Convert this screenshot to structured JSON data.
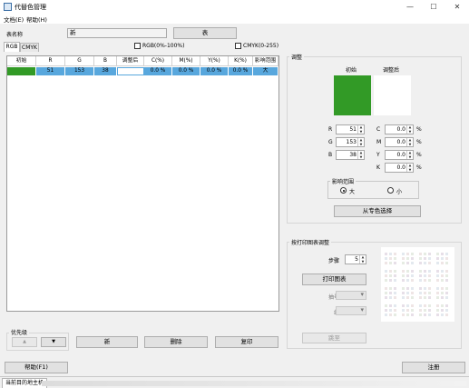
{
  "window": {
    "title": "代替色管理",
    "minimize_glyph": "—",
    "maximize_glyph": "☐",
    "close_glyph": "✕"
  },
  "menu": {
    "file": "文档(E)",
    "help": "帮助(H)"
  },
  "table_name": {
    "label": "表名称",
    "value": "新",
    "button": "表"
  },
  "tabs": {
    "rgb": "RGB",
    "cmyk": "CMYK"
  },
  "options": {
    "rgb_percent": "RGB(0%-100%)",
    "cmyk_range": "CMYK(0-255)"
  },
  "grid": {
    "headers": [
      "初始",
      "R",
      "G",
      "B",
      "调整后",
      "C(%)",
      "M(%)",
      "Y(%)",
      "K(%)",
      "影响范围"
    ],
    "rows": [
      {
        "swatch_color": "#329a26",
        "r": "51",
        "g": "153",
        "b": "38",
        "after_color": "#ffffff",
        "c": "0.0 %",
        "m": "0.0 %",
        "y": "0.0 %",
        "k": "0.0 %",
        "range": "大"
      }
    ]
  },
  "priority": {
    "label": "优先级",
    "up": "▲",
    "down": "▼"
  },
  "actions": {
    "new": "新",
    "delete": "删除",
    "copy": "复印"
  },
  "adjust": {
    "title": "调整",
    "initial_label": "初始",
    "after_label": "调整后",
    "initial_color": "#329a26",
    "after_color": "#ffffff",
    "r_label": "R",
    "g_label": "G",
    "b_label": "B",
    "r": "51",
    "g": "153",
    "b": "38",
    "c_label": "C",
    "m_label": "M",
    "y_label": "Y",
    "k_label": "K",
    "c": "0.0",
    "m": "0.0",
    "y": "0.0",
    "k": "0.0",
    "percent": "%",
    "range_title": "影响范围",
    "range_large": "大",
    "range_small": "小",
    "range_selected": "large",
    "spot_button": "从专色选择"
  },
  "print_chart": {
    "title": "按打印图表调整",
    "step_label": "步骤",
    "step_value": "5",
    "print_button": "打印图表",
    "pick_label": "抽号",
    "group_label": "组",
    "apply_button": "跳至"
  },
  "bottom": {
    "help_button": "帮助(F1)",
    "register_button": "注册"
  },
  "status": {
    "tab": "当前目的地主机"
  }
}
